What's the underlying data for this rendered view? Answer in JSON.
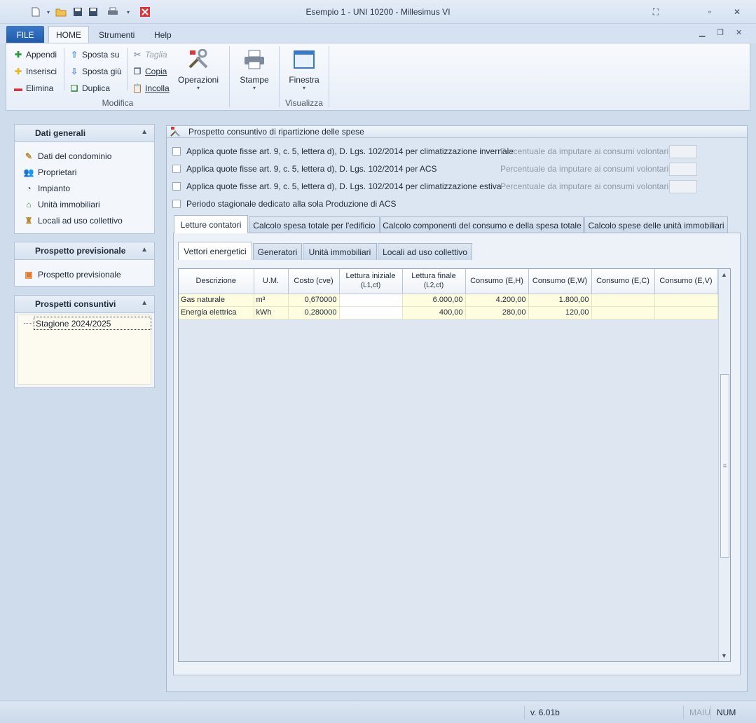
{
  "window": {
    "title": "Esempio 1 - UNI 10200 - Millesimus VI"
  },
  "ribbon_tabs": [
    "FILE",
    "HOME",
    "Strumenti",
    "Help"
  ],
  "ribbon": {
    "modifica": {
      "label": "Modifica",
      "appendi": "Appendi",
      "inserisci": "Inserisci",
      "elimina": "Elimina",
      "sposta_su": "Sposta su",
      "sposta_giu": "Sposta giù",
      "duplica": "Duplica",
      "taglia": "Taglia",
      "copia": "Copia",
      "incolla": "Incolla",
      "operazioni": "Operazioni"
    },
    "stampe": "Stampe",
    "visualizza": {
      "label": "Visualizza",
      "finestra": "Finestra"
    }
  },
  "sidebar": {
    "dati_generali": {
      "title": "Dati generali",
      "items": [
        "Dati del condominio",
        "Proprietari",
        "Impianto",
        "Unità immobiliari",
        "Locali ad uso collettivo"
      ]
    },
    "prospetto_previsionale": {
      "title": "Prospetto previsionale",
      "items": [
        "Prospetto previsionale"
      ]
    },
    "prospetti_consuntivi": {
      "title": "Prospetti consuntivi",
      "items": [
        "Stagione 2024/2025"
      ]
    }
  },
  "main": {
    "title": "Prospetto consuntivo di ripartizione delle spese",
    "checks": [
      "Applica quote fisse art. 9, c. 5, lettera d), D. Lgs. 102/2014 per climatizzazione invernale",
      "Applica quote fisse art. 9, c. 5, lettera d), D. Lgs. 102/2014 per ACS",
      "Applica quote fisse art. 9, c. 5, lettera d), D. Lgs. 102/2014 per climatizzazione estiva",
      "Periodo stagionale dedicato alla sola Produzione di ACS"
    ],
    "pct_label": "Percentuale da imputare ai consumi volontari:",
    "tabs": [
      "Letture contatori",
      "Calcolo spesa totale per l'edificio",
      "Calcolo componenti del consumo e della spesa totale",
      "Calcolo spese delle unità immobiliari"
    ],
    "subtabs": [
      "Vettori energetici",
      "Generatori",
      "Unità immobiliari",
      "Locali ad uso collettivo"
    ],
    "grid": {
      "headers": [
        {
          "main": "Descrizione",
          "sub": ""
        },
        {
          "main": "U.M.",
          "sub": ""
        },
        {
          "main": "Costo (cve)",
          "sub": ""
        },
        {
          "main": "Lettura iniziale",
          "sub": "(L1,ct)"
        },
        {
          "main": "Lettura finale",
          "sub": "(L2,ct)"
        },
        {
          "main": "Consumo  (E,H)",
          "sub": ""
        },
        {
          "main": "Consumo  (E,W)",
          "sub": ""
        },
        {
          "main": "Consumo  (E,C)",
          "sub": ""
        },
        {
          "main": "Consumo  (E,V)",
          "sub": ""
        }
      ],
      "rows": [
        [
          "Gas naturale",
          "m³",
          "0,670000",
          "",
          "6.000,00",
          "4.200,00",
          "1.800,00",
          "",
          ""
        ],
        [
          "Energia elettrica",
          "kWh",
          "0,280000",
          "",
          "400,00",
          "280,00",
          "120,00",
          "",
          ""
        ]
      ]
    }
  },
  "status": {
    "version": "v. 6.01b",
    "caps": "MAIU",
    "num": "NUM"
  }
}
